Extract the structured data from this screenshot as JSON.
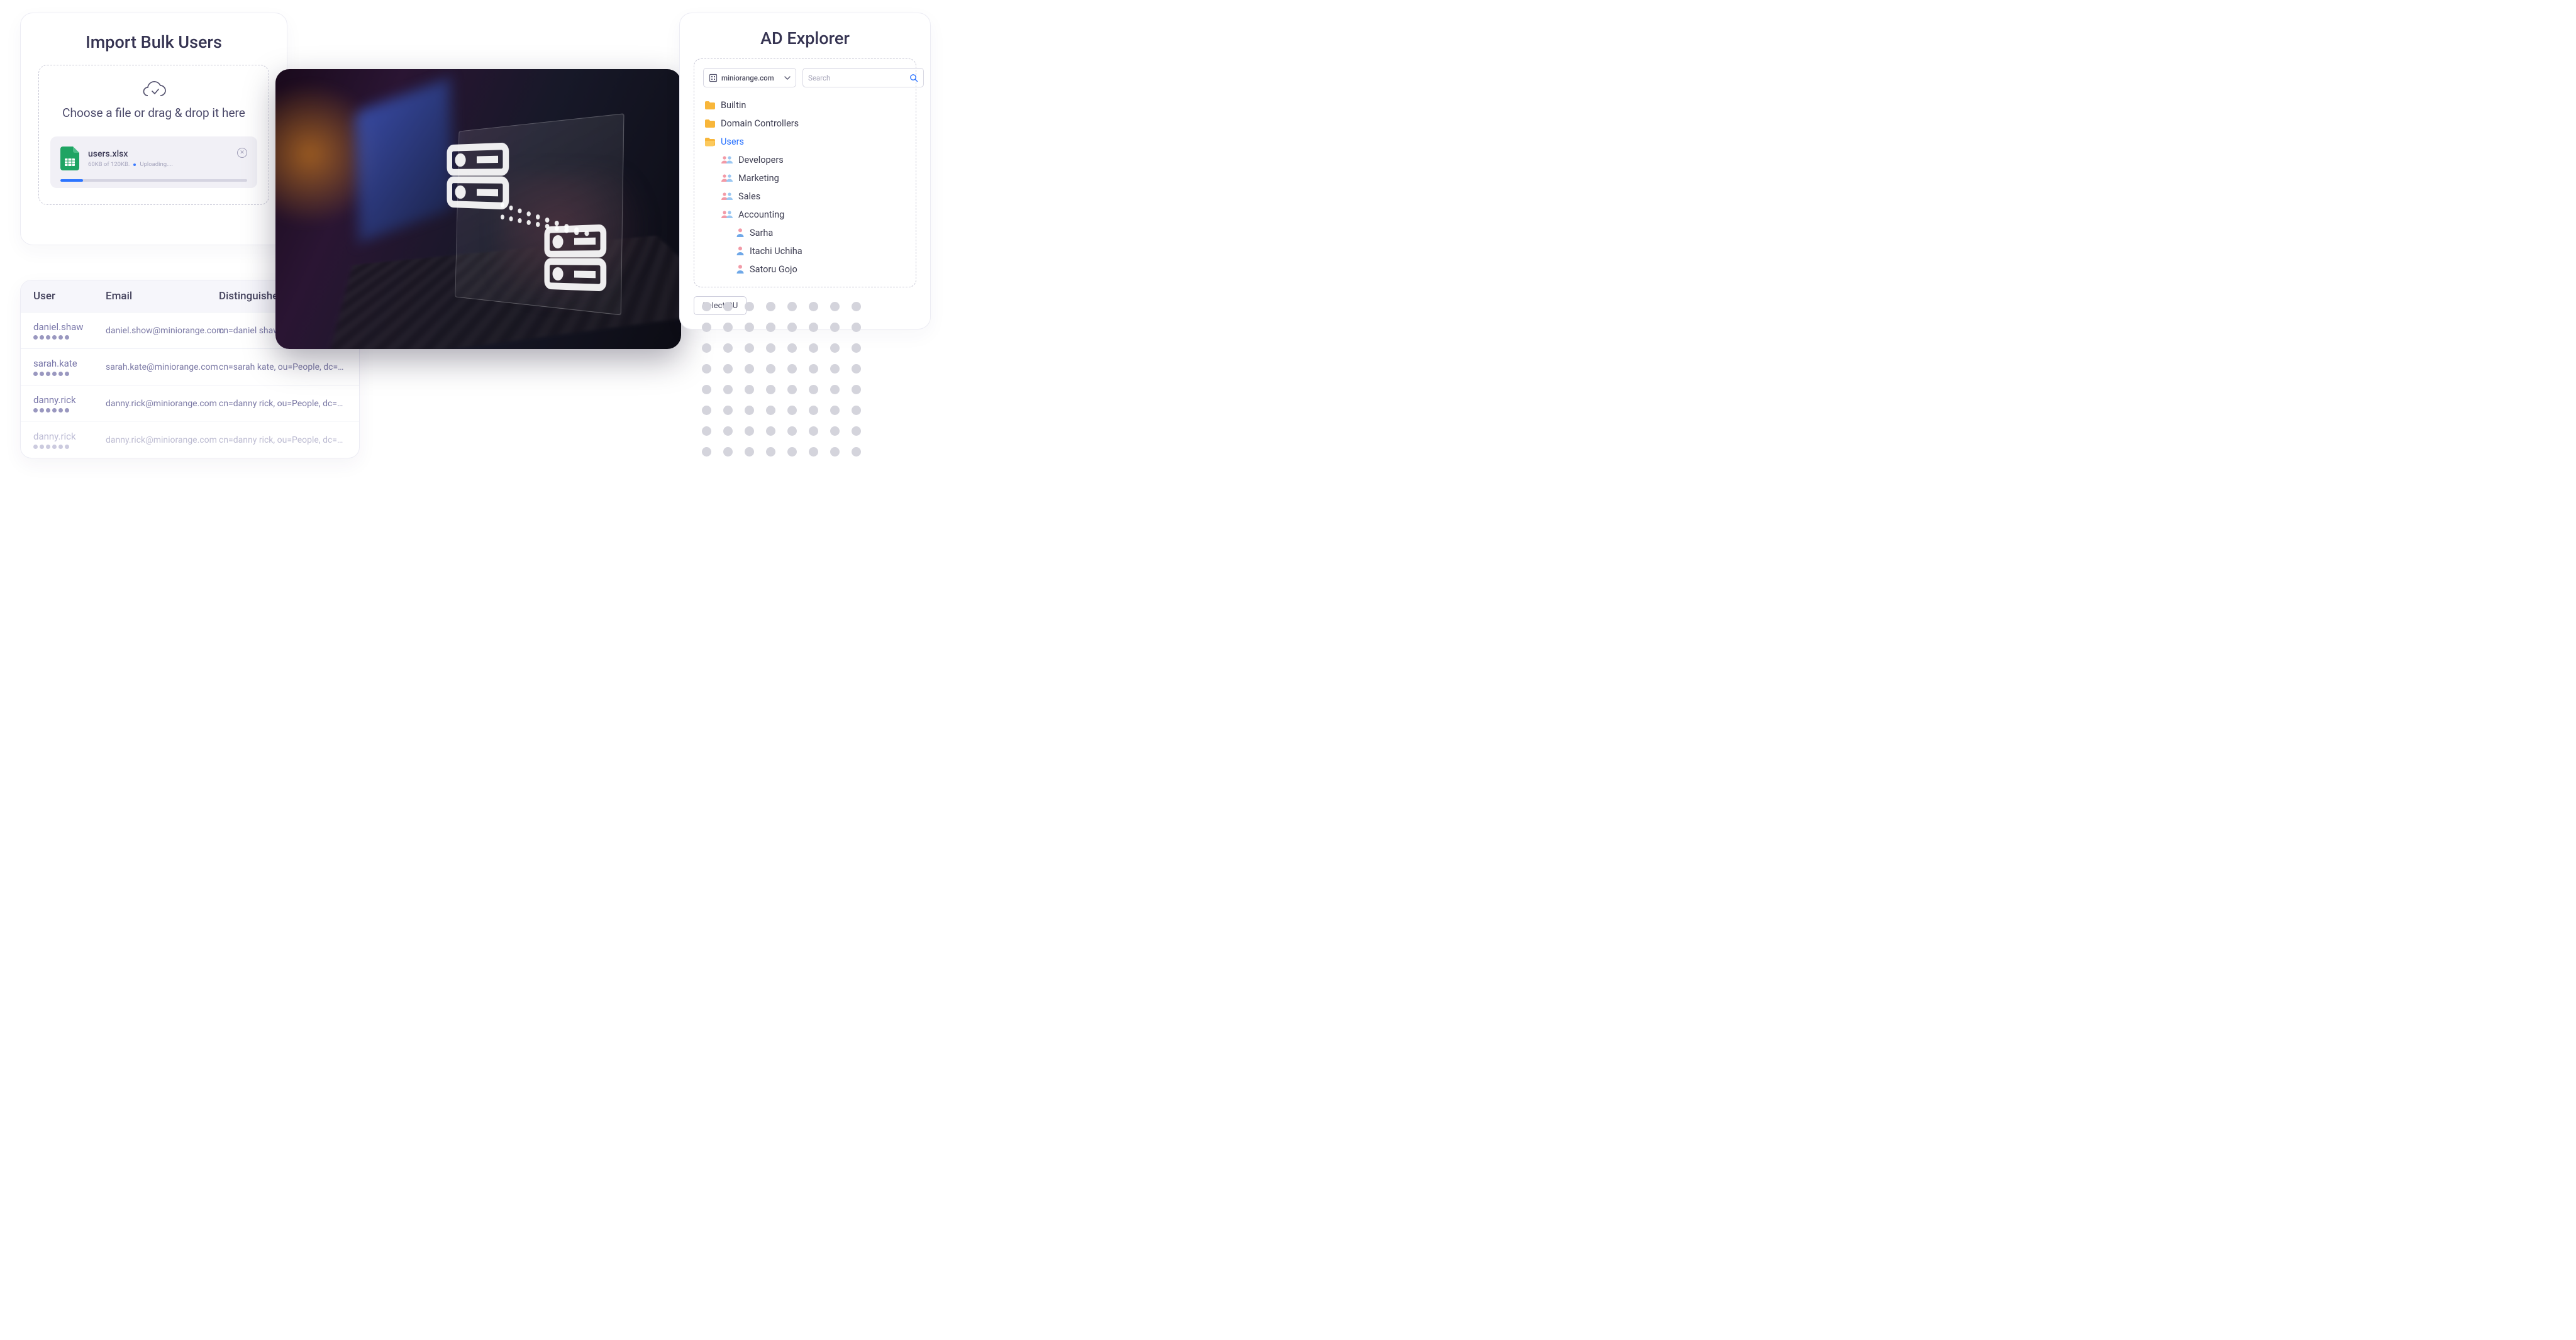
{
  "import": {
    "title": "Import Bulk Users",
    "instruction": "Choose a file or drag & drop it here",
    "file": {
      "name": "users.xlsx",
      "size": "60KB of 120KB.",
      "status": "Uploading...."
    },
    "progress_percent": 12
  },
  "table": {
    "headers": {
      "user": "User",
      "email": "Email",
      "dn": "Distinguished Name"
    },
    "rows": [
      {
        "user": "daniel.shaw",
        "email": "daniel.show@miniorange.com",
        "dn": "cn=daniel shaw, ou=People, dc=sun..."
      },
      {
        "user": "sarah.kate",
        "email": "sarah.kate@miniorange.com",
        "dn": "cn=sarah kate, ou=People, dc=sun..."
      },
      {
        "user": "danny.rick",
        "email": "danny.rick@miniorange.com",
        "dn": "cn=danny rick, ou=People, dc=sun....."
      },
      {
        "user": "danny.rick",
        "email": "danny.rick@miniorange.com",
        "dn": "cn=danny rick, ou=People, dc=sun....."
      }
    ]
  },
  "ad": {
    "title": "AD Explorer",
    "domain": "miniorange.com",
    "search_placeholder": "Search",
    "tree": {
      "builtin": "Builtin",
      "domain_controllers": "Domain Controllers",
      "users": "Users",
      "groups": {
        "developers": "Developers",
        "marketing": "Marketing",
        "sales": "Sales",
        "accounting": "Accounting"
      },
      "people": {
        "sarha": "Sarha",
        "itachi": "Itachi Uchiha",
        "gojo": "Satoru Gojo"
      }
    },
    "select_ou": "Select OU"
  }
}
